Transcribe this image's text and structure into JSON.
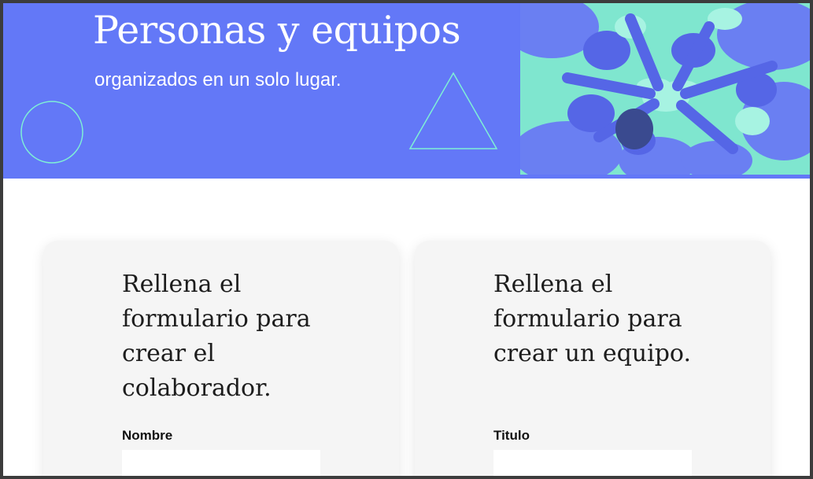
{
  "hero": {
    "title": "Personas y equipos",
    "subtitle": "organizados en un solo lugar.",
    "background_color": "#6378f7",
    "accent_color": "#7ff0d6"
  },
  "collaborator_form": {
    "heading": "Rellena el formulario para crear el colaborador.",
    "field_label": "Nombre",
    "field_value": ""
  },
  "team_form": {
    "heading": "Rellena el formulario para crear un equipo.",
    "field_label": "Titulo",
    "field_value": ""
  }
}
